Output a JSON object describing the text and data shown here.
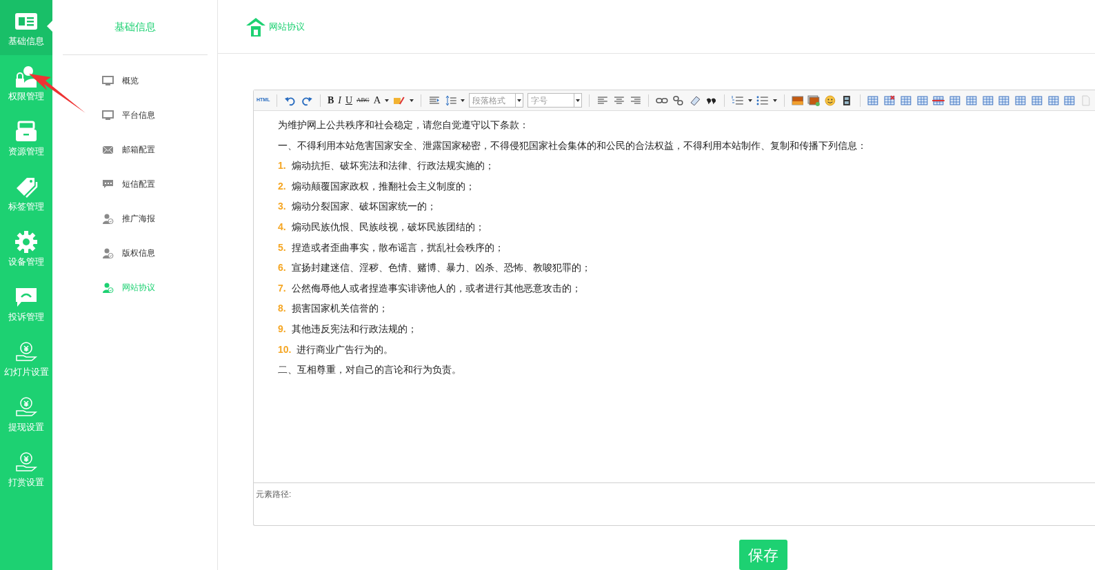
{
  "rail": [
    {
      "label": "基础信息",
      "selected": true
    },
    {
      "label": "权限管理",
      "selected": false
    },
    {
      "label": "资源管理",
      "selected": false
    },
    {
      "label": "标签管理",
      "selected": false
    },
    {
      "label": "设备管理",
      "selected": false
    },
    {
      "label": "投诉管理",
      "selected": false
    },
    {
      "label": "幻灯片设置",
      "selected": false
    },
    {
      "label": "提现设置",
      "selected": false
    },
    {
      "label": "打赏设置",
      "selected": false
    }
  ],
  "submenu": {
    "title": "基础信息",
    "items": [
      {
        "label": "概览",
        "selected": false
      },
      {
        "label": "平台信息",
        "selected": false
      },
      {
        "label": "邮箱配置",
        "selected": false
      },
      {
        "label": "短信配置",
        "selected": false
      },
      {
        "label": "推广海报",
        "selected": false
      },
      {
        "label": "版权信息",
        "selected": false
      },
      {
        "label": "网站协议",
        "selected": true
      }
    ]
  },
  "page_title": "网站协议",
  "toolbar": {
    "html": "HTML",
    "format_buttons": [
      "B",
      "I",
      "U",
      "ABC",
      "A"
    ],
    "selects": [
      {
        "placeholder": "段落格式"
      },
      {
        "placeholder": "字号"
      }
    ]
  },
  "content": {
    "intro": "为维护网上公共秩序和社会稳定，请您自觉遵守以下条款：",
    "clause_1": "一、不得利用本站危害国家安全、泄露国家秘密，不得侵犯国家社会集体的和公民的合法权益，不得利用本站制作、复制和传播下列信息：",
    "items": [
      {
        "number": "1.",
        "text": "煽动抗拒、破坏宪法和法律、行政法规实施的；"
      },
      {
        "number": "2.",
        "text": "煽动颠覆国家政权，推翻社会主义制度的；"
      },
      {
        "number": "3.",
        "text": "煽动分裂国家、破坏国家统一的；"
      },
      {
        "number": "4.",
        "text": "煽动民族仇恨、民族歧视，破坏民族团结的；"
      },
      {
        "number": "5.",
        "text": "捏造或者歪曲事实，散布谣言，扰乱社会秩序的；"
      },
      {
        "number": "6.",
        "text": "宣扬封建迷信、淫秽、色情、赌博、暴力、凶杀、恐怖、教唆犯罪的；"
      },
      {
        "number": "7.",
        "text": "公然侮辱他人或者捏造事实诽谤他人的，或者进行其他恶意攻击的；"
      },
      {
        "number": "8.",
        "text": "损害国家机关信誉的；"
      },
      {
        "number": "9.",
        "text": "其他违反宪法和行政法规的；"
      },
      {
        "number": "10.",
        "text": "进行商业广告行为的。"
      }
    ],
    "clause_2": "二、互相尊重，对自己的言论和行为负责。"
  },
  "element_path": "元素路径:",
  "save_button": "保存"
}
